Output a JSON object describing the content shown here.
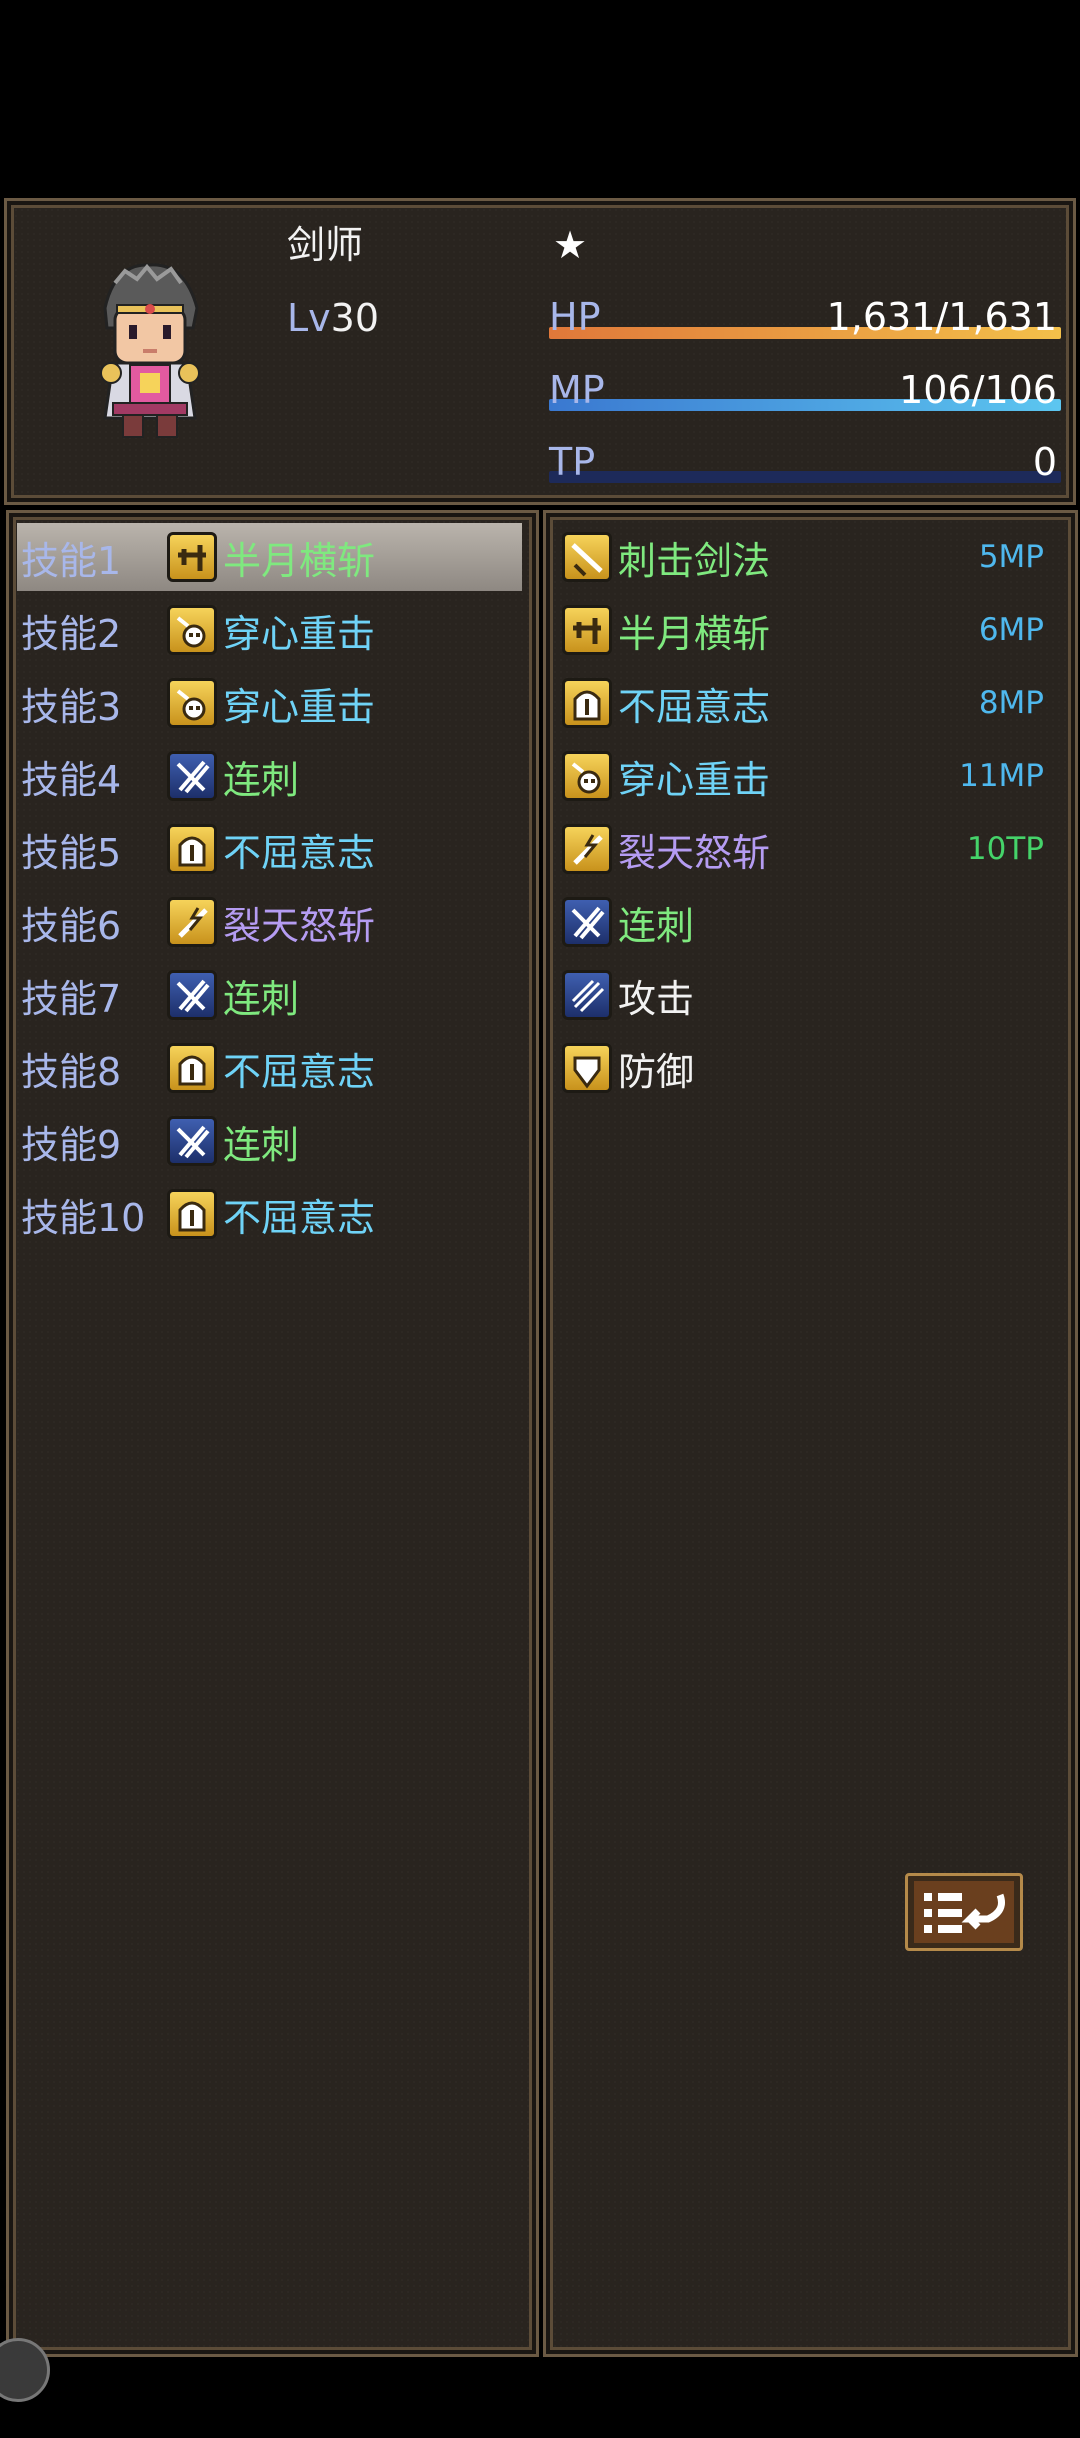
{
  "actor": {
    "class_name": "剑师",
    "star": "★",
    "level_label": "Lv",
    "level": "30",
    "hp_label": "HP",
    "hp_value": "1,631/1,631",
    "hp_fraction": 1.0,
    "mp_label": "MP",
    "mp_value": "106/106",
    "mp_fraction": 1.0,
    "tp_label": "TP",
    "tp_value": "0",
    "tp_fraction": 0.0
  },
  "slots": [
    {
      "label": "技能1",
      "skill": "半月横斩",
      "icon": "sword-slash-icon",
      "color": "green",
      "selected": true
    },
    {
      "label": "技能2",
      "skill": "穿心重击",
      "icon": "skull-strike-icon",
      "color": "cyan"
    },
    {
      "label": "技能3",
      "skill": "穿心重击",
      "icon": "skull-strike-icon",
      "color": "cyan"
    },
    {
      "label": "技能4",
      "skill": "连刺",
      "icon": "claw-slash-icon",
      "color": "green"
    },
    {
      "label": "技能5",
      "skill": "不屈意志",
      "icon": "helmet-icon",
      "color": "cyan"
    },
    {
      "label": "技能6",
      "skill": "裂天怒斩",
      "icon": "lightning-sword-icon",
      "color": "purple"
    },
    {
      "label": "技能7",
      "skill": "连刺",
      "icon": "claw-slash-icon",
      "color": "green"
    },
    {
      "label": "技能8",
      "skill": "不屈意志",
      "icon": "helmet-icon",
      "color": "cyan"
    },
    {
      "label": "技能9",
      "skill": "连刺",
      "icon": "claw-slash-icon",
      "color": "green"
    },
    {
      "label": "技能10",
      "skill": "不屈意志",
      "icon": "helmet-icon",
      "color": "cyan"
    }
  ],
  "skills": [
    {
      "name": "刺击剑法",
      "cost": "5MP",
      "icon": "sword-thrust-icon",
      "color": "green",
      "cost_type": "mp"
    },
    {
      "name": "半月横斩",
      "cost": "6MP",
      "icon": "sword-slash-icon",
      "color": "green",
      "cost_type": "mp"
    },
    {
      "name": "不屈意志",
      "cost": "8MP",
      "icon": "helmet-icon",
      "color": "cyan",
      "cost_type": "mp"
    },
    {
      "name": "穿心重击",
      "cost": "11MP",
      "icon": "skull-strike-icon",
      "color": "cyan",
      "cost_type": "mp"
    },
    {
      "name": "裂天怒斩",
      "cost": "10TP",
      "icon": "lightning-sword-icon",
      "color": "purple",
      "cost_type": "tp"
    },
    {
      "name": "连刺",
      "cost": "",
      "icon": "claw-slash-icon",
      "color": "green",
      "cost_type": ""
    },
    {
      "name": "攻击",
      "cost": "",
      "icon": "slash-attack-icon",
      "color": "white",
      "cost_type": ""
    },
    {
      "name": "防御",
      "cost": "",
      "icon": "shield-icon",
      "color": "white",
      "cost_type": ""
    }
  ],
  "buttons": {
    "back": "back-return-icon"
  },
  "colors": {
    "hp_gradient": [
      "#e0783a",
      "#f3c04a"
    ],
    "mp_gradient": [
      "#3a78d0",
      "#5cc6f0"
    ],
    "tp_track": "#1d2a5a"
  }
}
